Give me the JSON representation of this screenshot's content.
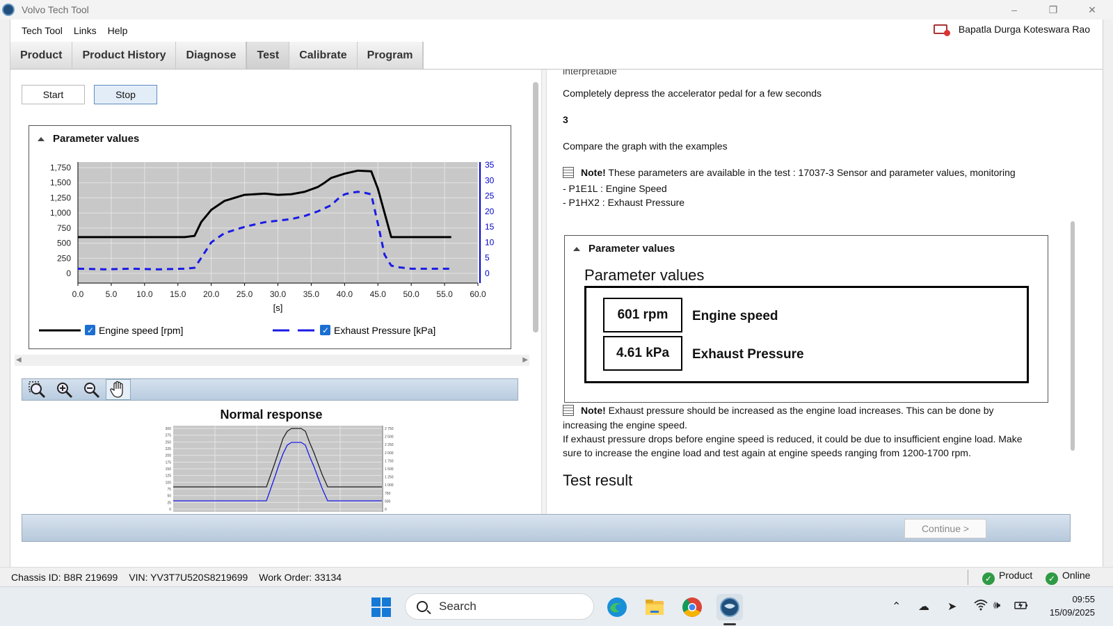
{
  "window": {
    "title": "Volvo Tech Tool",
    "minimize": "–",
    "restore": "❐",
    "close": "✕"
  },
  "menu": {
    "items": [
      "Tech Tool",
      "Links",
      "Help"
    ],
    "user": "Bapatla Durga Koteswara Rao"
  },
  "tabs": [
    "Product",
    "Product History",
    "Diagnose",
    "Test",
    "Calibrate",
    "Program"
  ],
  "active_tab": "Test",
  "buttons": {
    "start": "Start",
    "stop": "Stop"
  },
  "panel_title": "Parameter values",
  "chart_data": {
    "type": "line",
    "title": "",
    "xlabel": "[s]",
    "x_ticks": [
      "0.0",
      "5.0",
      "10.0",
      "15.0",
      "20.0",
      "25.0",
      "30.0",
      "35.0",
      "40.0",
      "45.0",
      "50.0",
      "55.0",
      "60.0"
    ],
    "y_left_ticks": [
      "0",
      "250",
      "500",
      "750",
      "1,000",
      "1,250",
      "1,500",
      "1,750"
    ],
    "y_right_ticks": [
      "0",
      "5",
      "10",
      "15",
      "20",
      "25",
      "30",
      "35"
    ],
    "xlim": [
      0,
      60
    ],
    "ylim_left": [
      0,
      1750
    ],
    "ylim_right": [
      0,
      35
    ],
    "grid": true,
    "series": [
      {
        "name": "Engine speed [rpm]",
        "axis": "left",
        "color": "#000000",
        "x": [
          0,
          16,
          17.5,
          18.5,
          20,
          22,
          25,
          28,
          30,
          32,
          34,
          36,
          37,
          38,
          40,
          42,
          44,
          45,
          46,
          47,
          49,
          52,
          56
        ],
        "y": [
          600,
          600,
          620,
          850,
          1050,
          1200,
          1300,
          1320,
          1300,
          1310,
          1350,
          1430,
          1500,
          1580,
          1650,
          1700,
          1690,
          1400,
          1000,
          600,
          600,
          600,
          600
        ]
      },
      {
        "name": "Exhaust Pressure [kPa]",
        "axis": "right",
        "color": "#1a1ae6",
        "x": [
          0,
          4,
          8,
          12,
          16,
          17.5,
          18.5,
          20,
          22,
          25,
          28,
          30,
          32,
          34,
          36,
          38,
          39,
          40,
          41,
          42,
          43,
          44,
          45,
          46,
          47,
          48,
          50,
          52,
          54,
          56
        ],
        "y": [
          1.5,
          1.3,
          1.5,
          1.3,
          1.5,
          1.8,
          5,
          10,
          13,
          15,
          16.5,
          17,
          17.5,
          18.5,
          20,
          22,
          24,
          25.5,
          26,
          26.3,
          26,
          25.5,
          16,
          6,
          2.5,
          2,
          1.5,
          1.5,
          1.5,
          1.5
        ]
      }
    ]
  },
  "legend": {
    "engine": "Engine speed [rpm]",
    "exhaust": "Exhaust Pressure [kPa]"
  },
  "toolbar_icons": [
    "zoom-fit-icon",
    "zoom-in-icon",
    "zoom-out-icon",
    "pan-hand-icon"
  ],
  "normal_response": {
    "title": "Normal response",
    "left_ticks": [
      "0",
      "25",
      "50",
      "75",
      "100",
      "125",
      "150",
      "175",
      "200",
      "225",
      "250",
      "275",
      "300"
    ],
    "right_ticks": [
      "0",
      "500",
      "750",
      "1 000",
      "1 250",
      "1 500",
      "1 750",
      "2 000",
      "2 250",
      "2 500",
      "2 750"
    ]
  },
  "instructions": {
    "truncated_top": "interpretable",
    "step_text": "Completely depress the accelerator pedal for a few seconds",
    "step_number": "3",
    "compare_text": "Compare the graph with the examples",
    "note1_label": "Note!",
    "note1_text": " These parameters are available in the test : 17037-3 Sensor and parameter values, monitoring",
    "param1": "- P1E1L : Engine Speed",
    "param2": "- P1HX2 : Exhaust Pressure"
  },
  "param_values": {
    "heading": "Parameter values",
    "big_title": "Parameter values",
    "rows": [
      {
        "value": "601 rpm",
        "label": "Engine speed"
      },
      {
        "value": "4.61 kPa",
        "label": "Exhaust Pressure"
      }
    ]
  },
  "note2": {
    "label": "Note!",
    "line1": " Exhaust pressure should be increased as the engine load increases. This can be done by",
    "line2": "increasing the engine speed.",
    "line3": "If exhaust pressure drops before engine speed is reduced, it could be due to insufficient engine load. Make",
    "line4": "sure to increase the engine load and test again at engine speeds ranging from 1200-1700 rpm."
  },
  "test_result": "Test result",
  "continue_button": "Continue >",
  "status": {
    "chassis": "Chassis ID: B8R 219699",
    "vin": "VIN: YV3T7U520S8219699",
    "work_order": "Work Order: 33134",
    "product": "Product",
    "online": "Online"
  },
  "taskbar": {
    "search": "Search",
    "time": "09:55",
    "date": "15/09/2025"
  },
  "colors": {
    "engine": "#000000",
    "exhaust": "#1a1ae6",
    "plot_bg": "#c8c8c8",
    "status_ok": "#2f9a44"
  }
}
